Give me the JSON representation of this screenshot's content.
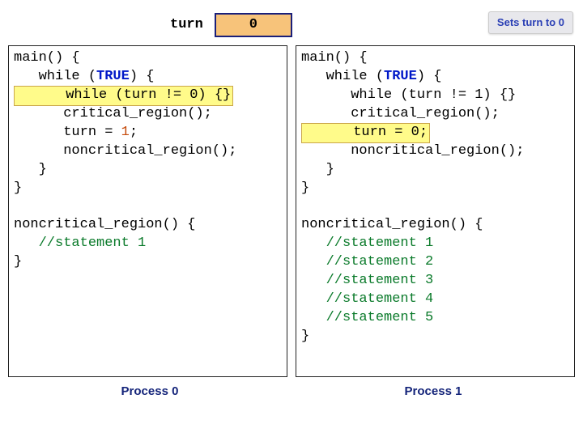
{
  "turn": {
    "label": "turn",
    "value": "0"
  },
  "note": "Sets turn to 0",
  "p0": {
    "caption": "Process 0",
    "main_sig": "main() {",
    "while_open": "   while (",
    "true": "TRUE",
    "while_close": ") {",
    "hl_line": "      while (turn != 0) {}",
    "l_crit": "      critical_region();",
    "l_set_open": "      turn = ",
    "l_set_val": "1",
    "l_set_close": ";",
    "l_noncrit": "      noncritical_region();",
    "l_braceA": "   }",
    "l_braceB": "}",
    "nc_sig": "noncritical_region() {",
    "nc_body": "   //statement 1",
    "nc_end": "}"
  },
  "p1": {
    "caption": "Process 1",
    "main_sig": "main() {",
    "while_open": "   while (",
    "true": "TRUE",
    "while_close": ") {",
    "l_spin": "      while (turn != 1) {}",
    "l_crit": "      critical_region();",
    "hl_line": "      turn = 0;",
    "l_noncrit": "      noncritical_region();",
    "l_braceA": "   }",
    "l_braceB": "}",
    "nc_sig": "noncritical_region() {",
    "nc_b1": "   //statement 1",
    "nc_b2": "   //statement 2",
    "nc_b3": "   //statement 3",
    "nc_b4": "   //statement 4",
    "nc_b5": "   //statement 5",
    "nc_end": "}"
  }
}
